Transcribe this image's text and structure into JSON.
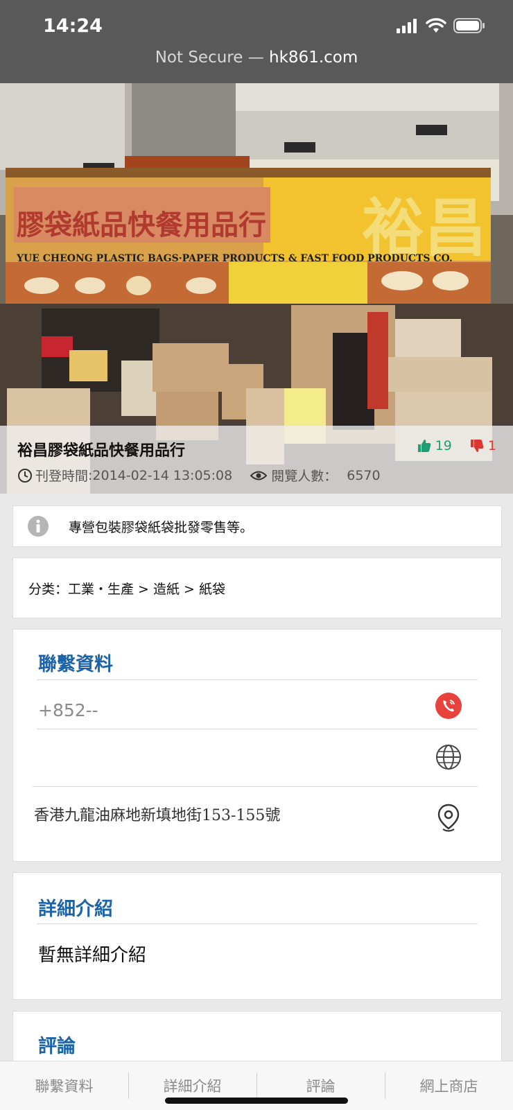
{
  "status_bar": {
    "time": "14:24"
  },
  "browser": {
    "security_label": "Not Secure — ",
    "host": "hk861.com"
  },
  "shop": {
    "title": "裕昌膠袋紙品快餐用品行",
    "posted_label": "刊登時間",
    "posted_value": ":2014-02-14 13:05:08",
    "views_label": "閱覽人數：",
    "views_value": "6570",
    "likes": "19",
    "dislikes": "1",
    "sign": {
      "chinese": "裕昌",
      "chinese_line": "膠袋紙品快餐用品行",
      "english": "YUE CHEONG PLASTIC BAGS·PAPER PRODUCTS & FAST FOOD PRODUCTS CO."
    }
  },
  "notice": {
    "icon": "info-icon",
    "text": "專營包裝膠袋紙袋批發零售等。"
  },
  "category": {
    "text": "分类：工業・生產 > 造紙 > 紙袋"
  },
  "contact": {
    "title": "聯繫資料",
    "phone": "+852--",
    "address": "香港九龍油麻地新填地街153-155號",
    "phone_icon": "phone-icon",
    "web_icon": "globe-icon",
    "map_icon": "location-pin-icon"
  },
  "detail": {
    "title": "詳細介紹",
    "text": "暫無詳細介紹"
  },
  "reviews": {
    "title": "評論"
  },
  "tabs": [
    {
      "label": "聯繫資料"
    },
    {
      "label": "詳細介紹"
    },
    {
      "label": "評論"
    },
    {
      "label": "網上商店"
    }
  ],
  "colors": {
    "accent": "#1d63a8",
    "like": "#1f9d74",
    "dislike": "#d9372f",
    "call": "#e8423d"
  }
}
